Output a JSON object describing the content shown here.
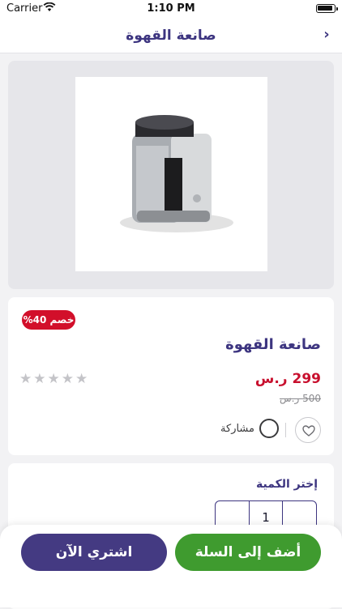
{
  "status": {
    "carrier": "Carrier",
    "time": "1:10 PM"
  },
  "nav": {
    "title": "صانعة القهوة",
    "back_icon": "chevron-right-icon"
  },
  "product": {
    "badge": "خصم 40%",
    "name": "صانعة القهوة",
    "price": "299 ر.س",
    "old_price": "500 ر.س",
    "rating": 0,
    "rating_max": 5,
    "share_label": "مشاركة"
  },
  "quantity": {
    "label": "إختر الكمية",
    "value": "1"
  },
  "actions": {
    "add_to_cart": "أضف إلى السلة",
    "buy_now": "اشتري الآن"
  },
  "colors": {
    "brand": "#3d3580",
    "add_to_cart": "#3f9b2f",
    "buy_now": "#443a82",
    "sale": "#d20f2a",
    "price": "#c8102e"
  }
}
